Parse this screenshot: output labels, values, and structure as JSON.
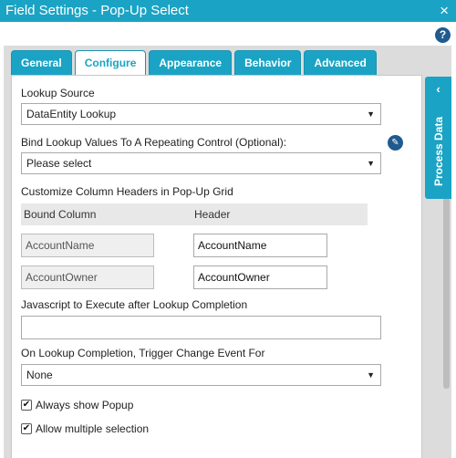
{
  "window": {
    "title": "Field Settings - Pop-Up Select",
    "close_icon": "×"
  },
  "help_icon": "?",
  "tabs": [
    {
      "label": "General"
    },
    {
      "label": "Configure",
      "active": true
    },
    {
      "label": "Appearance"
    },
    {
      "label": "Behavior"
    },
    {
      "label": "Advanced"
    }
  ],
  "configure": {
    "lookup_source": {
      "label": "Lookup Source",
      "value": "DataEntity Lookup"
    },
    "bind_lookup": {
      "label": "Bind Lookup Values To A Repeating Control (Optional):",
      "value": "Please select"
    },
    "column_headers": {
      "label": "Customize Column Headers in Pop-Up Grid",
      "col_bound": "Bound Column",
      "col_header": "Header",
      "rows": [
        {
          "bound": "AccountName",
          "header": "AccountName"
        },
        {
          "bound": "AccountOwner",
          "header": "AccountOwner"
        }
      ]
    },
    "javascript": {
      "label": "Javascript to Execute after Lookup Completion",
      "value": ""
    },
    "trigger_change": {
      "label": "On Lookup Completion, Trigger Change Event For",
      "value": "None"
    },
    "always_show_popup": {
      "label": "Always show Popup",
      "checked": true
    },
    "allow_multiple": {
      "label": "Allow multiple selection",
      "checked": true
    }
  },
  "side_panel": {
    "label": "Process Data",
    "chevron": "‹"
  },
  "colors": {
    "accent": "#1aa3c4",
    "icon_blue": "#1f5b8e",
    "dialog_bg": "#dcdcdc"
  }
}
